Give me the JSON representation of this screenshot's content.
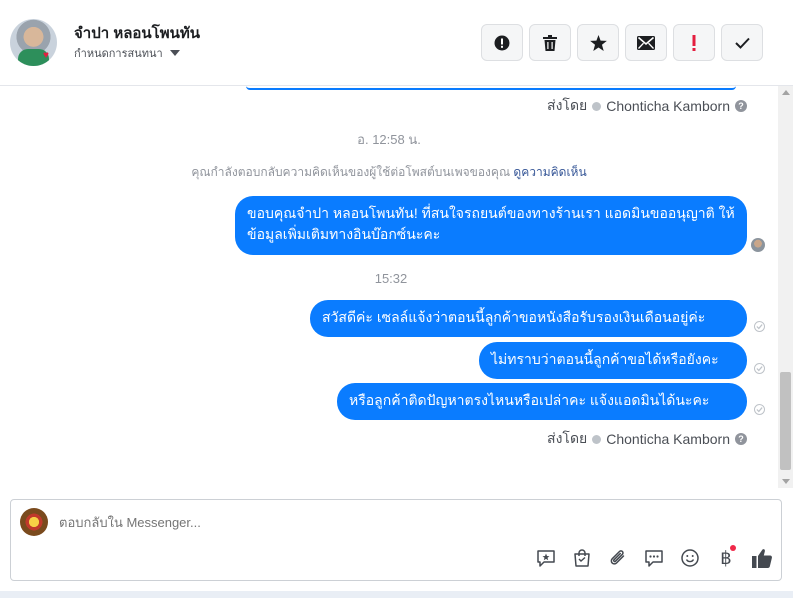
{
  "header": {
    "contact_name": "จำปา หลอนโพนทัน",
    "subtitle": "กำหนดการสนทนา",
    "actions": [
      {
        "icon": "exclamation-circle-icon"
      },
      {
        "icon": "trash-icon"
      },
      {
        "icon": "star-icon"
      },
      {
        "icon": "envelope-icon"
      },
      {
        "icon": "red-exclamation-icon"
      },
      {
        "icon": "checkmark-icon"
      }
    ]
  },
  "thread": {
    "sent_by_label": "ส่งโดย",
    "sent_by_name": "Chonticha Kamborn",
    "timestamp_1": "อ. 12:58 น.",
    "notice_text": "คุณกำลังตอบกลับความคิดเห็นของผู้ใช้ต่อโพสต์บนเพจของคุณ",
    "notice_link": "ดูความคิดเห็น",
    "message_1": "ขอบคุณจำปา หลอนโพนทัน! ที่สนใจรถยนต์ของทางร้านเรา แอดมินขออนุญาติ ให้ข้อมูลเพิ่มเติมทางอินบ๊อกซ์นะคะ",
    "timestamp_2": "15:32",
    "message_2": "สวัสดีค่ะ เซลล์แจ้งว่าตอนนี้ลูกค้าขอหนังสือรับรองเงินเดือนอยู่ค่ะ",
    "message_3": "ไม่ทราบว่าตอนนี้ลูกค้าขอได้หรือยังคะ",
    "message_4": "หรือลูกค้าติดปัญหาตรงไหนหรือเปล่าคะ แจ้งแอดมินได้นะคะ"
  },
  "composer": {
    "placeholder": "ตอบกลับใน Messenger...",
    "tools": [
      "saved-reply-icon",
      "shop-bag-icon",
      "paperclip-icon",
      "chat-bubble-icon",
      "emoji-icon",
      "baht-payment-icon",
      "thumbs-up-icon"
    ]
  },
  "colors": {
    "bubble": "#0a7cff",
    "link": "#385898",
    "muted": "#90949c"
  }
}
